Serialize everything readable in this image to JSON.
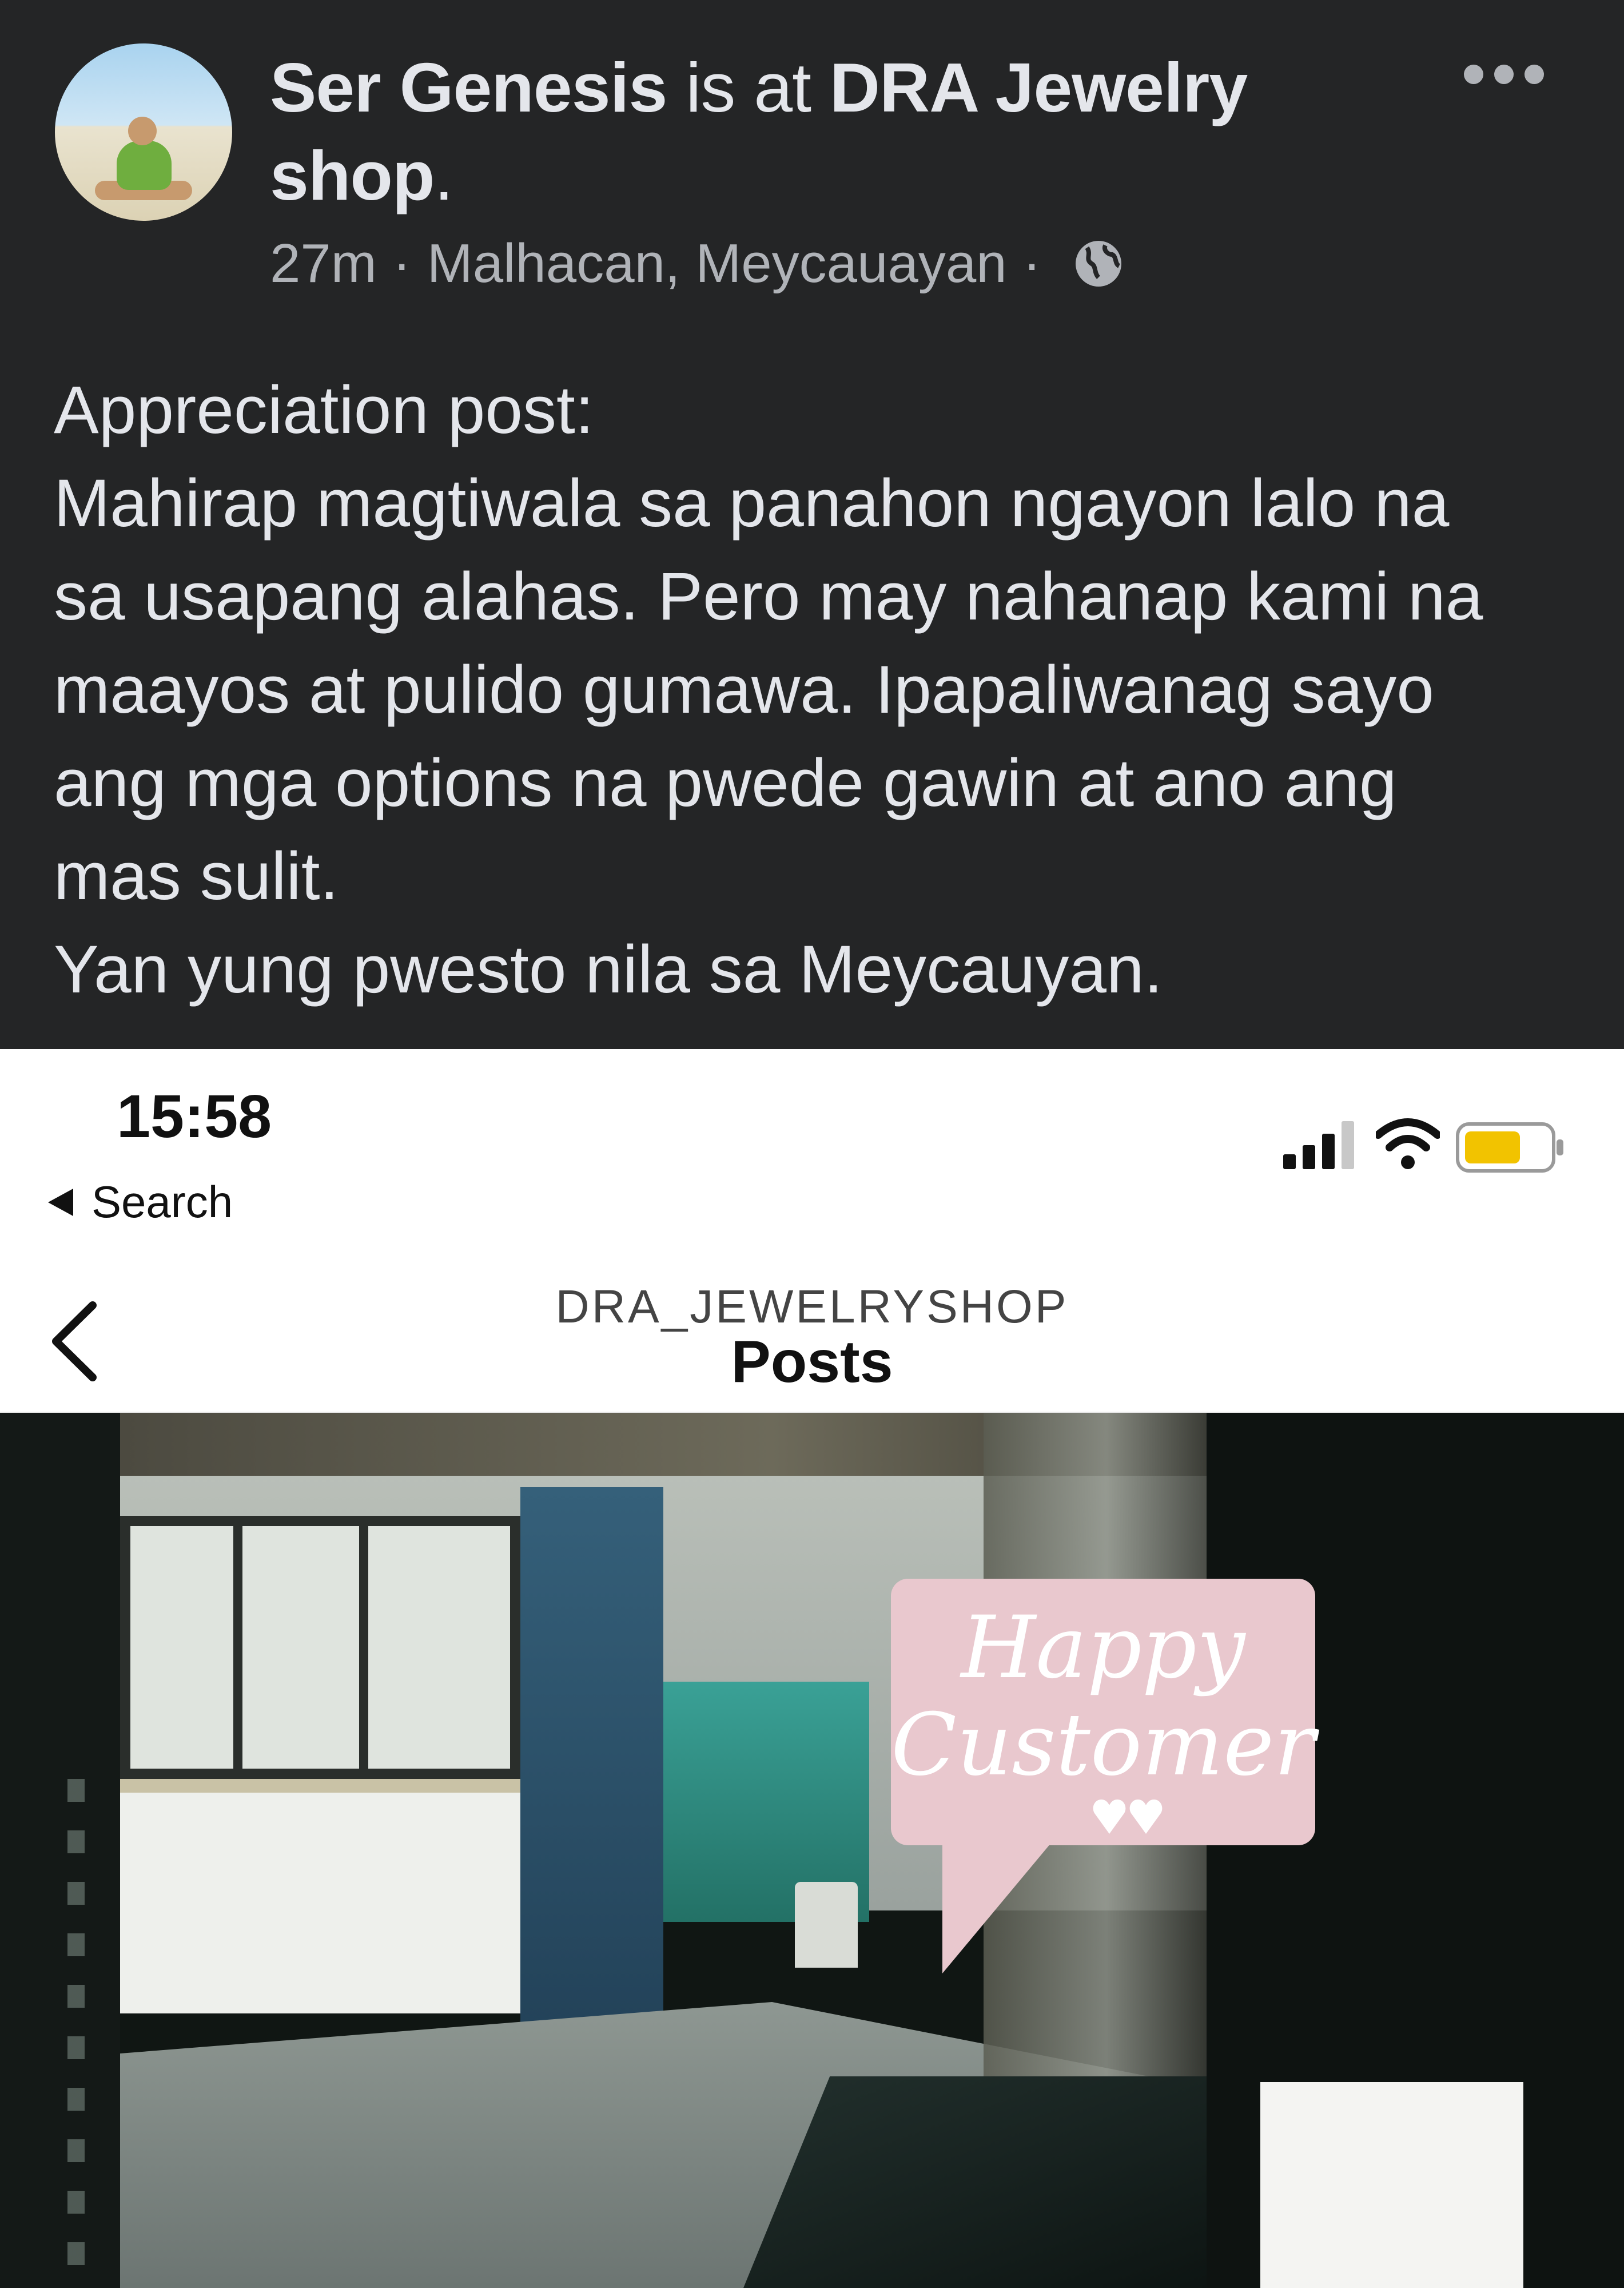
{
  "post": {
    "author": "Ser Genesis",
    "is_at": "is at",
    "place_line1": "DRA Jewelry",
    "place_line2": "shop",
    "period": ".",
    "time": "27m",
    "separator": "·",
    "location": "Malhacan, Meycauayan",
    "privacy_icon": "globe-icon",
    "more_icon": "more-horizontal-icon",
    "body_lines": [
      "Appreciation post:",
      "Mahirap magtiwala sa panahon ngayon lalo na",
      "sa usapang alahas. Pero may nahanap kami na",
      "maayos at pulido gumawa. Ipapaliwanag sayo",
      "ang mga options na pwede gawin at ano ang",
      "mas sulit.",
      "Yan yung pwesto nila sa Meycauyan."
    ]
  },
  "screenshot": {
    "status_time": "15:58",
    "back_label": "Search",
    "username": "DRA_JEWELRYSHOP",
    "title": "Posts",
    "bubble_line1": "Happy",
    "bubble_line2": "Customer",
    "colors": {
      "battery": "#f2c300",
      "bubble": "#e9c8ce"
    }
  }
}
